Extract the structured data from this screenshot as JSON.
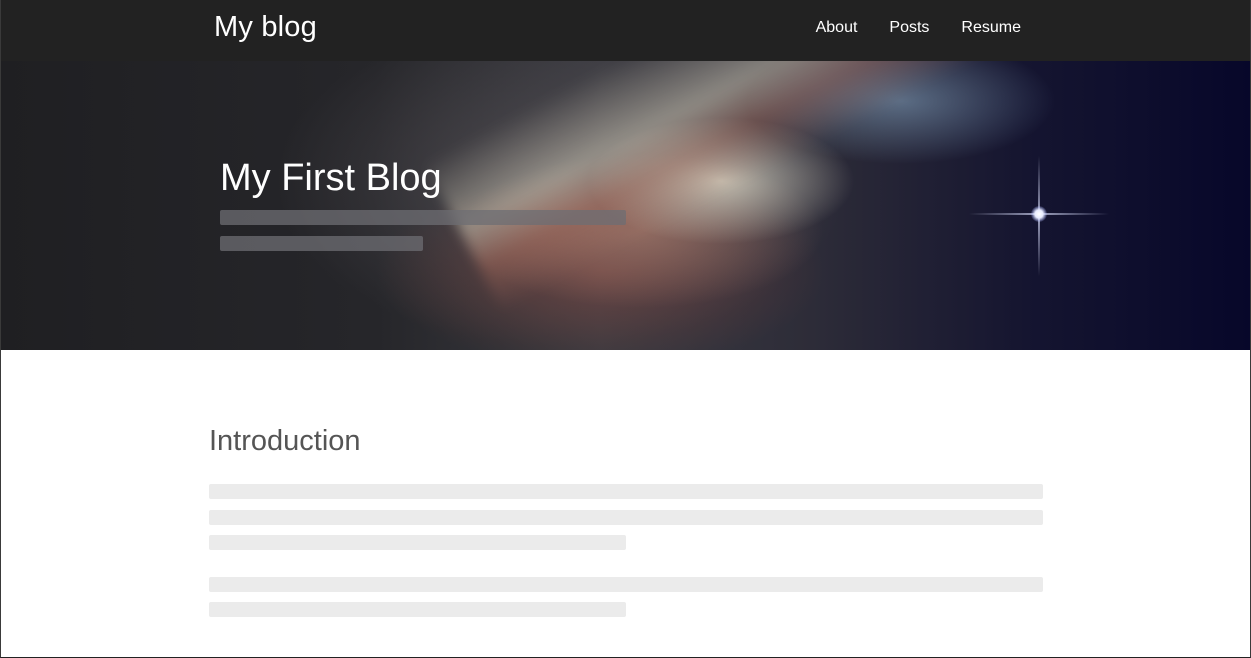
{
  "navbar": {
    "brand": "My blog",
    "links": [
      {
        "label": "About"
      },
      {
        "label": "Posts"
      },
      {
        "label": "Resume"
      }
    ]
  },
  "hero": {
    "title": "My First Blog",
    "subtitle_placeholder_lines": 2
  },
  "content": {
    "section_title": "Introduction",
    "paragraphs": [
      {
        "placeholder_lines": 3
      },
      {
        "placeholder_lines": 2
      }
    ]
  },
  "colors": {
    "navbar_bg": "#222222",
    "nav_text": "#ffffff",
    "heading_text": "#555555",
    "placeholder_bar": "#ebebeb"
  }
}
